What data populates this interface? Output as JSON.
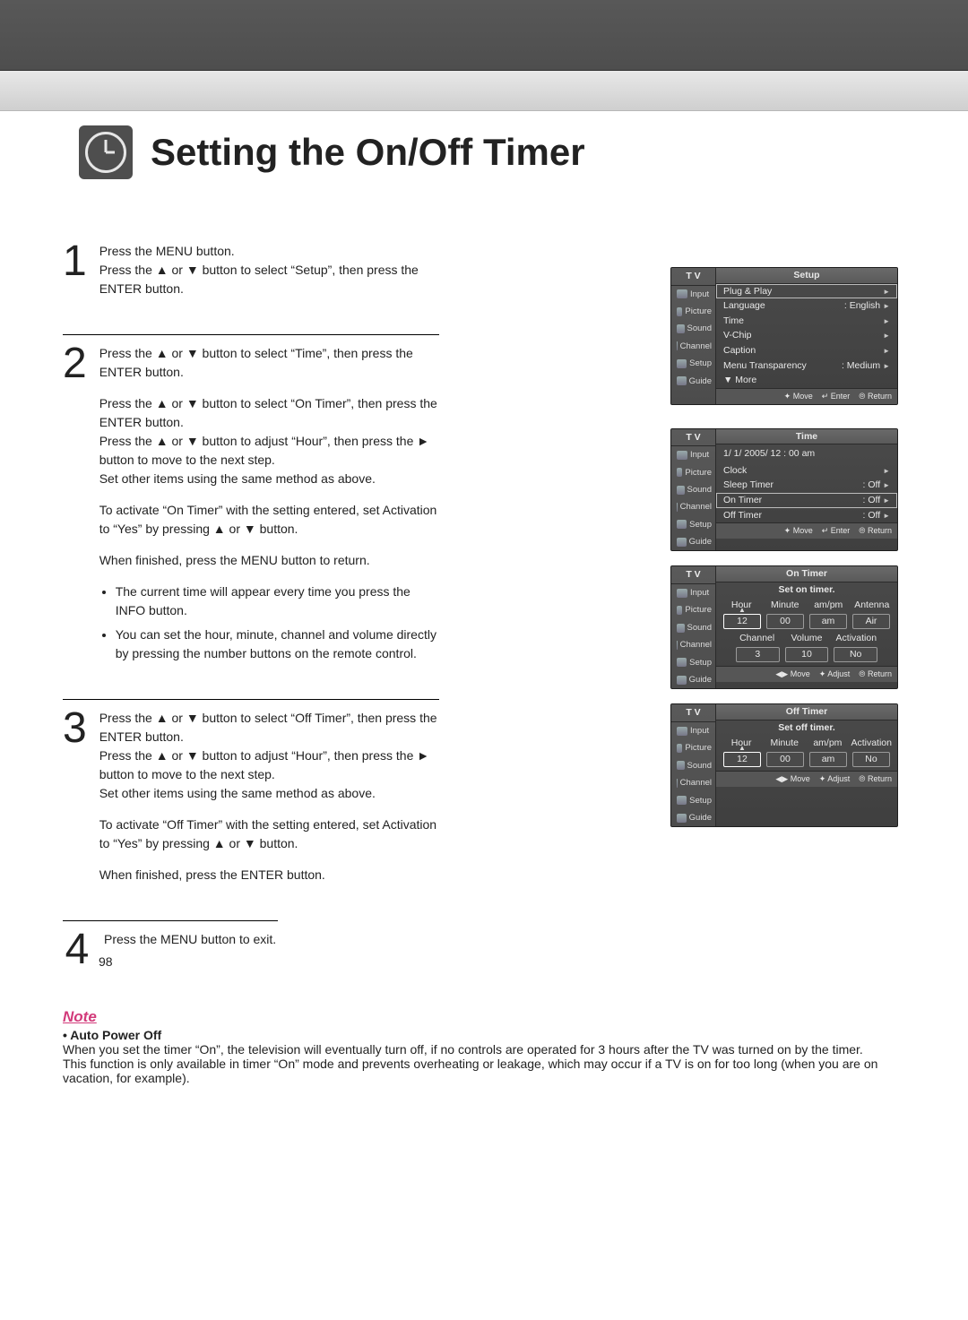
{
  "page_title": "Setting the On/Off Timer",
  "page_number": "98",
  "steps": [
    {
      "num": "1",
      "paras": [
        "Press the MENU button.",
        "Press the ▲ or ▼ button to select “Setup”, then press the ENTER button."
      ]
    },
    {
      "num": "2",
      "paras": [
        "Press the ▲ or ▼ button to select “Time”, then press the ENTER button.",
        "Press the ▲ or ▼ button to select “On Timer”, then press the ENTER button.",
        "Press the ▲ or ▼ button to adjust “Hour”, then press the ► button to move to the next step.",
        "Set other items using the same method as above.",
        "To activate “On Timer” with  the setting entered, set Activation to “Yes” by pressing ▲ or ▼ button.",
        "When finished, press the MENU button to return."
      ],
      "bullets": [
        "The current time will appear every time you press the INFO button.",
        "You can set the hour, minute, channel and volume directly by pressing the number buttons on the remote control."
      ]
    },
    {
      "num": "3",
      "paras": [
        "Press the ▲ or ▼ button to select “Off Timer”, then press the ENTER button.",
        "Press the ▲ or ▼ button to adjust “Hour”, then press the ► button to move to the next step.",
        "Set other items using the same method as above.",
        "To activate “Off Timer” with  the setting entered, set Activation to “Yes” by pressing ▲ or ▼ button.",
        "When finished, press the ENTER button."
      ]
    },
    {
      "num": "4",
      "paras": [
        "Press the MENU button to exit."
      ]
    }
  ],
  "note": {
    "heading": "Note",
    "sub": "• Auto Power Off",
    "body": "When you set the timer “On”, the television will eventually turn off, if no controls are operated for 3 hours after the TV was turned on by the timer.\nThis function is only available in timer “On” mode and prevents overheating or leakage, which may occur if a TV is on for too long (when you are on vacation, for example)."
  },
  "osd_common": {
    "tv": "T V",
    "side": [
      "Input",
      "Picture",
      "Sound",
      "Channel",
      "Setup",
      "Guide"
    ],
    "hint_move": "✦ Move",
    "hint_move_lr": "◀▶ Move",
    "hint_enter": "↵ Enter",
    "hint_adjust": "✦ Adjust",
    "hint_return": "⦾ Return"
  },
  "osd1": {
    "title": "Setup",
    "rows": [
      {
        "label": "Plug & Play",
        "value": "",
        "hi": true
      },
      {
        "label": "Language",
        "value": ": English"
      },
      {
        "label": "Time",
        "value": ""
      },
      {
        "label": "V-Chip",
        "value": ""
      },
      {
        "label": "Caption",
        "value": ""
      },
      {
        "label": "Menu Transparency",
        "value": ": Medium"
      },
      {
        "label": "▼ More",
        "value": "",
        "noarrow": true
      }
    ]
  },
  "osd2": {
    "title": "Time",
    "datetime": "1/ 1/ 2005/ 12 : 00  am",
    "rows": [
      {
        "label": "Clock",
        "value": ""
      },
      {
        "label": "Sleep Timer",
        "value": ": Off"
      },
      {
        "label": "On Timer",
        "value": ": Off",
        "hi": true
      },
      {
        "label": "Off Timer",
        "value": ": Off"
      }
    ]
  },
  "osd3": {
    "title": "On Timer",
    "subtitle": "Set on timer.",
    "cols1": [
      "Hour",
      "Minute",
      "am/pm",
      "Antenna"
    ],
    "vals1": [
      "12",
      "00",
      "am",
      "Air"
    ],
    "cols2": [
      "Channel",
      "Volume",
      "Activation"
    ],
    "vals2": [
      "3",
      "10",
      "No"
    ]
  },
  "osd4": {
    "title": "Off Timer",
    "subtitle": "Set off timer.",
    "cols1": [
      "Hour",
      "Minute",
      "am/pm",
      "Activation"
    ],
    "vals1": [
      "12",
      "00",
      "am",
      "No"
    ]
  }
}
